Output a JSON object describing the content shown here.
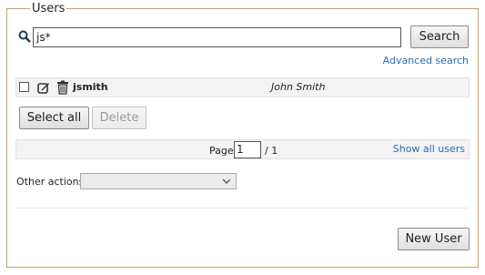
{
  "panel": {
    "legend": "Users"
  },
  "search": {
    "value": "js*",
    "button_label": "Search",
    "advanced_link": "Advanced search"
  },
  "users": [
    {
      "username": "jsmith",
      "full_name": "John Smith"
    }
  ],
  "actions": {
    "select_all_label": "Select all",
    "delete_label": "Delete",
    "new_user_label": "New User"
  },
  "pager": {
    "page_label": "Page",
    "current_page": "1",
    "total": "/ 1",
    "show_all_label": "Show all users"
  },
  "other_actions": {
    "label": "Other actions",
    "selected": ""
  },
  "colors": {
    "frame": "#c8a060",
    "link": "#2a6ab4",
    "row_bg": "#f3f3f3"
  }
}
